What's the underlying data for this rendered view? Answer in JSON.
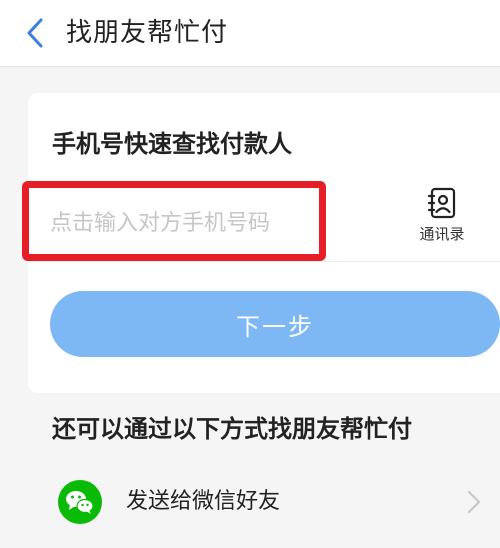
{
  "header": {
    "title": "找朋友帮忙付",
    "back_icon": "chevron-left-icon",
    "accent_color": "#3b7fd9"
  },
  "phone_section": {
    "title": "手机号快速查找付款人",
    "input_placeholder": "点击输入对方手机号码",
    "input_value": "",
    "highlight_color": "#e61e26",
    "contacts": {
      "icon": "contacts-icon",
      "label": "通讯录"
    }
  },
  "next_button": {
    "label": "下一步",
    "color": "#7db8f5"
  },
  "alternative": {
    "title": "还可以通过以下方式找朋友帮忙付",
    "options": [
      {
        "icon": "wechat-icon",
        "label": "发送给微信好友",
        "icon_color": "#09bb07"
      }
    ]
  }
}
